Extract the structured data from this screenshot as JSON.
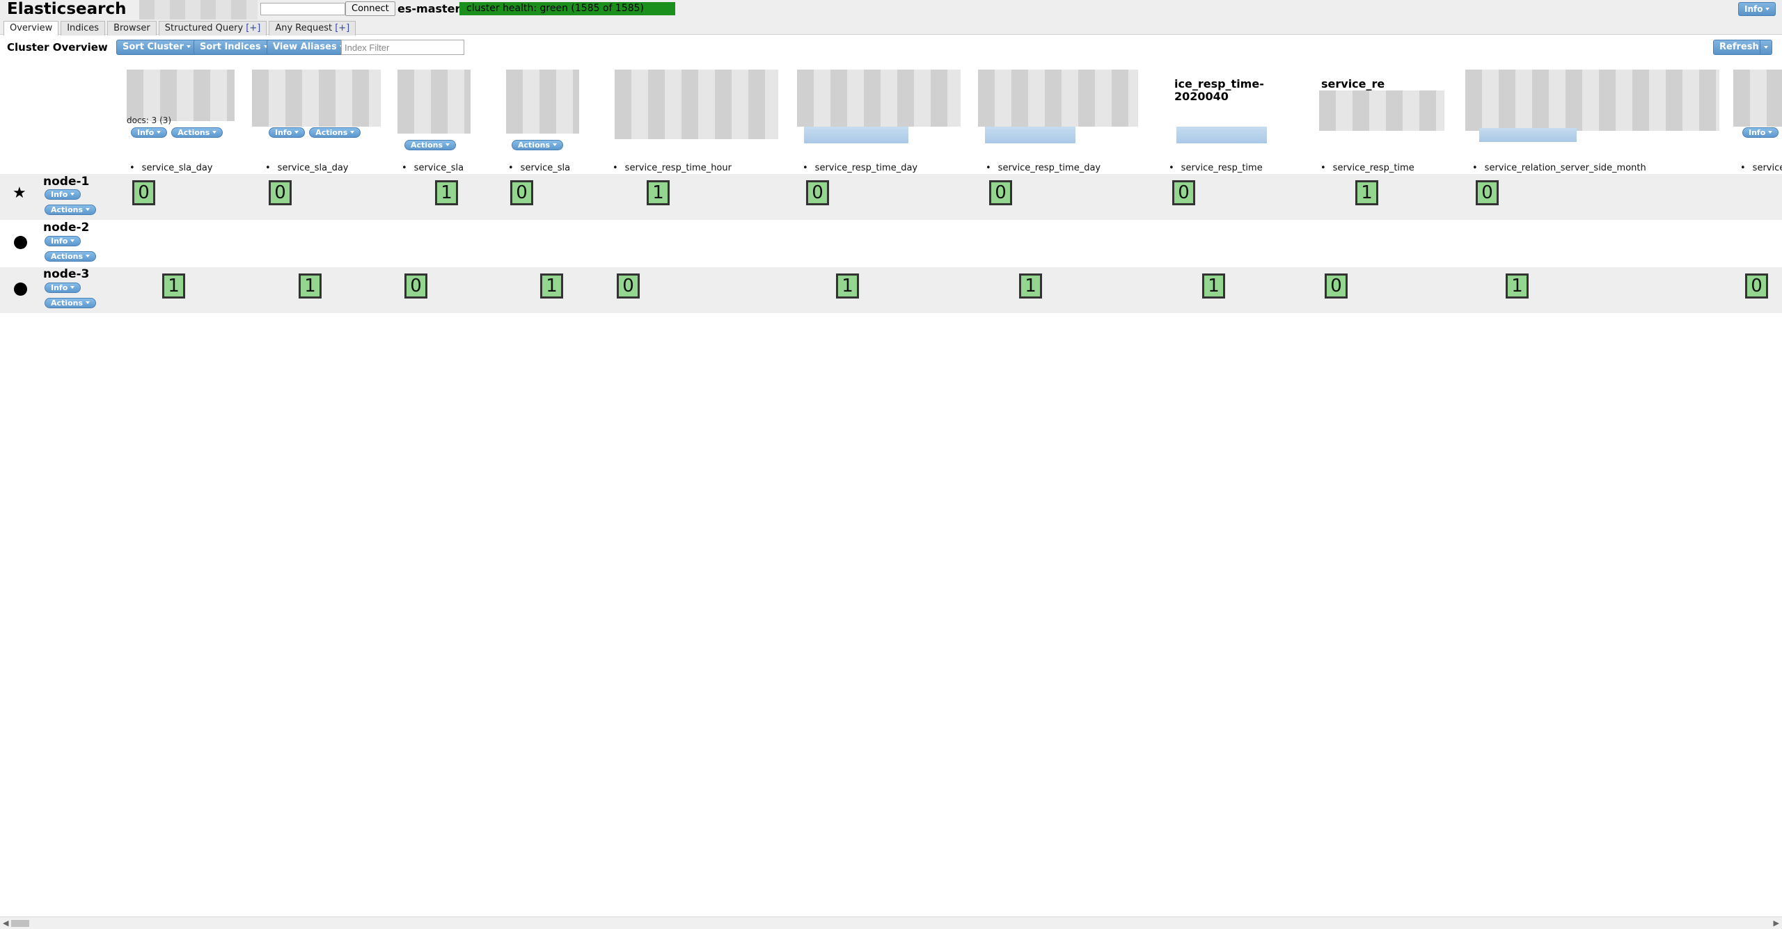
{
  "header": {
    "app_title": "Elasticsearch",
    "connect_label": "Connect",
    "connect_value": "",
    "cluster_name": "es-master",
    "cluster_health": "cluster health: green (1585 of 1585)",
    "info_label": "Info"
  },
  "tabs": [
    {
      "label": "Overview",
      "plus": ""
    },
    {
      "label": "Indices",
      "plus": ""
    },
    {
      "label": "Browser",
      "plus": ""
    },
    {
      "label": "Structured Query ",
      "plus": "[+]"
    },
    {
      "label": "Any Request ",
      "plus": "[+]"
    }
  ],
  "toolbar": {
    "section_title": "Cluster Overview",
    "sort_cluster": "Sort Cluster",
    "sort_indices": "Sort Indices",
    "view_aliases": "View Aliases",
    "index_filter_placeholder": "Index Filter",
    "refresh": "Refresh"
  },
  "pill_labels": {
    "info": "Info",
    "actions": "Actions"
  },
  "indices": [
    {
      "docs": "docs: 3 (3)",
      "alias": "service_sla_day"
    },
    {
      "alias": "service_sla_day"
    },
    {
      "alias": "service_sla"
    },
    {
      "alias": "service_sla"
    },
    {
      "alias": "service_resp_time_hour"
    },
    {
      "alias": "service_resp_time_day"
    },
    {
      "alias": "service_resp_time_day"
    },
    {
      "title_line1": "ice_resp_time-",
      "title_line2": "2020040",
      "alias": "service_resp_time"
    },
    {
      "title_line1": "service_re",
      "alias": "service_resp_time"
    },
    {
      "alias": "service_relation_server_side_month"
    },
    {
      "alias": "service"
    }
  ],
  "nodes": [
    {
      "name": "node-1",
      "icon": "star-icon",
      "shards": [
        "0",
        "0",
        "1",
        "0",
        "1",
        "0",
        "0",
        "0",
        "1",
        "0",
        ""
      ]
    },
    {
      "name": "node-2",
      "icon": "dot-icon",
      "shards": []
    },
    {
      "name": "node-3",
      "icon": "dot-icon",
      "shards": [
        "1",
        "1",
        "0",
        "1",
        "0",
        "1",
        "1",
        "1",
        "0",
        "1",
        "0"
      ]
    }
  ],
  "colors": {
    "health_green": "#1b8f1b",
    "shard_green": "#94d68f",
    "button_blue": "#5d98cd"
  }
}
